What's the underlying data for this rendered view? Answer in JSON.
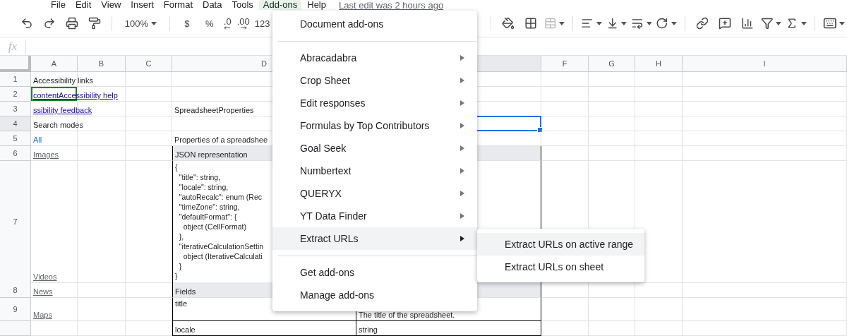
{
  "menu_bar": {
    "items": [
      {
        "label": "File",
        "selected": false
      },
      {
        "label": "Edit",
        "selected": false
      },
      {
        "label": "View",
        "selected": false
      },
      {
        "label": "Insert",
        "selected": false
      },
      {
        "label": "Format",
        "selected": false
      },
      {
        "label": "Data",
        "selected": false
      },
      {
        "label": "Tools",
        "selected": false
      },
      {
        "label": "Add-ons",
        "selected": true
      },
      {
        "label": "Help",
        "selected": false
      }
    ],
    "last_edit": "Last edit was 2 hours ago"
  },
  "toolbar": {
    "zoom": "100%",
    "currency": "$",
    "percent": "%",
    "decrease_decimals": ".0",
    "increase_decimals": ".00",
    "number_format": "123",
    "merge_disabled": true
  },
  "formula_bar": {
    "label": "fx"
  },
  "columns": [
    {
      "label": "A",
      "selected": false
    },
    {
      "label": "B",
      "selected": false
    },
    {
      "label": "C",
      "selected": false
    },
    {
      "label": "D",
      "selected": false
    },
    {
      "selected": true
    },
    {
      "label": "F",
      "selected": false
    },
    {
      "label": "G",
      "selected": false
    },
    {
      "label": "H",
      "selected": false
    },
    {
      "label": "I",
      "selected": false
    }
  ],
  "rows": [
    {
      "number": "1",
      "selected": false,
      "cells": {
        "a": {
          "kind": "text",
          "text": "Accessibility links"
        }
      }
    },
    {
      "number": "2",
      "selected": false,
      "cells": {
        "a": {
          "kind": "link",
          "text": "contentAccessibility help",
          "collaborator": true
        }
      }
    },
    {
      "number": "3",
      "selected": false,
      "cells": {
        "a": {
          "kind": "link",
          "text": "ssibility feedback"
        },
        "d": {
          "kind": "text",
          "text": "SpreadsheetProperties"
        }
      }
    },
    {
      "number": "4",
      "selected": true,
      "cells": {
        "a": {
          "kind": "text",
          "text": "Search modes"
        },
        "e": {
          "kind": "text",
          "active": true
        }
      }
    },
    {
      "number": "5",
      "selected": false,
      "cells": {
        "a": {
          "kind": "filter",
          "text": "All"
        },
        "d": {
          "kind": "text",
          "text": "Properties of a spreadshee"
        }
      }
    },
    {
      "number": "6",
      "selected": false,
      "boxed": true,
      "cells": {
        "a": {
          "kind": "web-link",
          "text": "Images"
        },
        "d": {
          "kind": "section",
          "text": "JSON representation"
        },
        "e": {
          "kind": "section"
        }
      }
    },
    {
      "number": "7",
      "selected": false,
      "boxed": true,
      "cells": {
        "a": {
          "kind": "web-link",
          "text": "Videos"
        },
        "d": {
          "kind": "code",
          "lines": [
            "{",
            "  \"title\": string,",
            "  \"locale\": string,",
            "  \"autoRecalc\": enum (Rec",
            "  \"timeZone\": string,",
            "  \"defaultFormat\": {",
            "    object (CellFormat)",
            "  },",
            "  \"iterativeCalculationSettin",
            "    object (IterativeCalculati",
            "  }",
            "}"
          ]
        }
      }
    },
    {
      "number": "8",
      "selected": false,
      "boxed": true,
      "cells": {
        "a": {
          "kind": "web-link",
          "text": "News"
        },
        "d": {
          "kind": "section",
          "text": "Fields"
        },
        "e": {
          "kind": "section"
        }
      }
    },
    {
      "number": "9",
      "selected": false,
      "boxed": true,
      "cells": {
        "a": {
          "kind": "web-link",
          "text": "Maps"
        },
        "d": {
          "kind": "top",
          "text": "title"
        },
        "e": {
          "kind": "text",
          "text": "The title of the spreadsheet."
        }
      }
    },
    {
      "selected": false,
      "boxed": true,
      "cells": {
        "d": {
          "kind": "text",
          "text": "locale"
        },
        "e": {
          "kind": "text",
          "text": "string"
        }
      }
    }
  ],
  "addons_menu": {
    "sections": [
      [
        {
          "label": "Document add-ons",
          "selected": false
        }
      ],
      [
        {
          "label": "Abracadabra",
          "submenu": true,
          "selected": false
        },
        {
          "label": "Crop Sheet",
          "submenu": true,
          "selected": false
        },
        {
          "label": "Edit responses",
          "submenu": true,
          "selected": false
        },
        {
          "label": "Formulas by Top Contributors",
          "submenu": true,
          "selected": false
        },
        {
          "label": "Goal Seek",
          "submenu": true,
          "selected": false
        },
        {
          "label": "Numbertext",
          "submenu": true,
          "selected": false
        },
        {
          "label": "QUERYX",
          "submenu": true,
          "selected": false
        },
        {
          "label": "YT Data Finder",
          "submenu": true,
          "selected": false
        },
        {
          "label": "Extract URLs",
          "submenu": true,
          "selected": true
        }
      ],
      [
        {
          "label": "Get add-ons",
          "selected": false
        },
        {
          "label": "Manage add-ons",
          "selected": false
        }
      ]
    ],
    "submenu": [
      {
        "label": "Extract URLs on active range",
        "selected": true
      },
      {
        "label": "Extract URLs on sheet",
        "selected": false
      }
    ]
  }
}
